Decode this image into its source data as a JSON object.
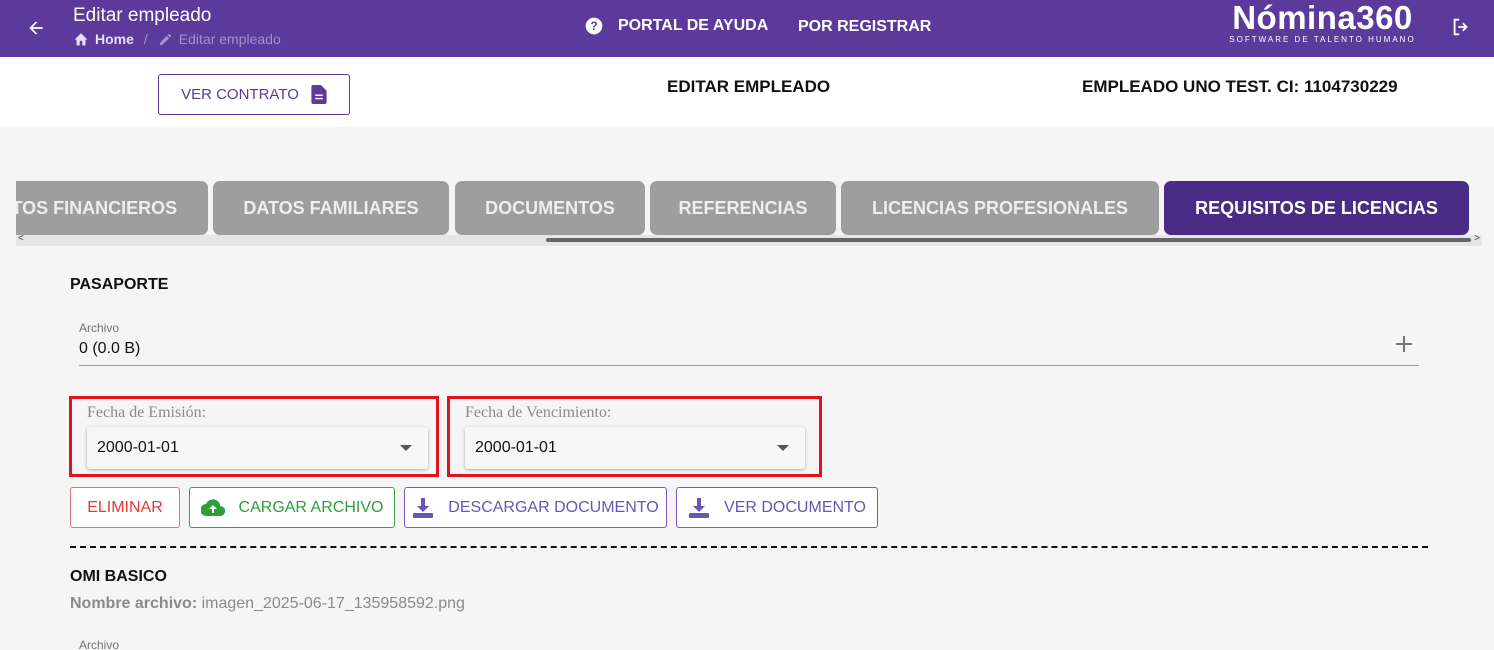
{
  "topbar": {
    "title": "Editar empleado",
    "breadcrumb_home": "Home",
    "breadcrumb_sep": "/",
    "breadcrumb_current": "Editar empleado",
    "help_label": "PORTAL DE AYUDA",
    "register_label": "POR REGISTRAR",
    "logo_name": "Nómina360",
    "logo_tagline": "SOFTWARE DE TALENTO HUMANO",
    "icons": [
      "arrow-left-icon",
      "home-icon",
      "pencil-icon",
      "help-circle-icon",
      "logout-icon"
    ]
  },
  "header": {
    "contract_button": "VER CONTRATO",
    "section_title": "EDITAR EMPLEADO",
    "employee_info": "EMPLEADO UNO TEST. CI: 1104730229"
  },
  "tabs": [
    {
      "label": "DATOS FINANCIEROS",
      "active": false
    },
    {
      "label": "DATOS FAMILIARES",
      "active": false
    },
    {
      "label": "DOCUMENTOS",
      "active": false
    },
    {
      "label": "REFERENCIAS",
      "active": false
    },
    {
      "label": "LICENCIAS PROFESIONALES",
      "active": false
    },
    {
      "label": "REQUISITOS DE LICENCIAS",
      "active": true
    }
  ],
  "pasaporte": {
    "title": "PASAPORTE",
    "file_label": "Archivo",
    "file_value": "0 (0.0 B)",
    "emission_label": "Fecha de Emisión:",
    "emission_value": "2000-01-01",
    "expiry_label": "Fecha de Vencimiento:",
    "expiry_value": "2000-01-01"
  },
  "actions": {
    "delete": "ELIMINAR",
    "upload": "CARGAR ARCHIVO",
    "download": "DESCARGAR DOCUMENTO",
    "view": "VER DOCUMENTO"
  },
  "omi": {
    "title": "OMI BASICO",
    "filename_label": "Nombre archivo:",
    "filename_value": "imagen_2025-06-17_135958592.png",
    "file_label": "Archivo"
  },
  "colors": {
    "primary": "#5b3a9b",
    "active_tab": "#4a2b86",
    "inactive_tab": "#9e9e9e",
    "highlight_border": "#e0141b",
    "danger": "#e53935",
    "success": "#2e9e3a"
  }
}
